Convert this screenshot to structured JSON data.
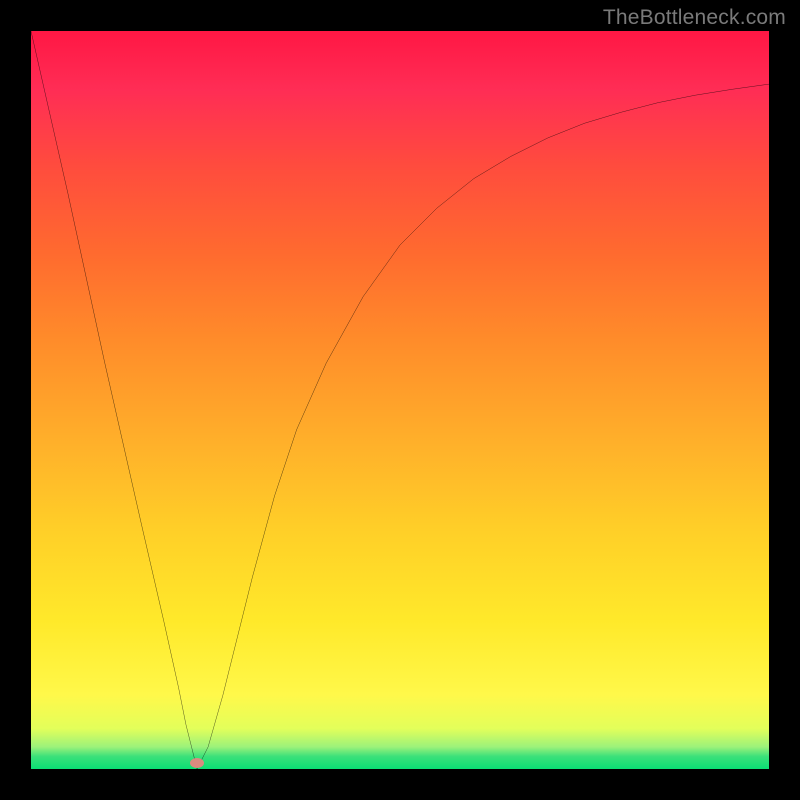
{
  "watermark": "TheBottleneck.com",
  "marker": {
    "x_pct": 22.5,
    "y_pct": 99.2
  },
  "chart_data": {
    "type": "line",
    "title": "",
    "xlabel": "",
    "ylabel": "",
    "xlim": [
      0,
      100
    ],
    "ylim": [
      0,
      100
    ],
    "series": [
      {
        "name": "bottleneck-curve",
        "x": [
          0,
          5,
          10,
          15,
          18,
          20,
          21,
          22.5,
          24,
          26,
          28,
          30,
          33,
          36,
          40,
          45,
          50,
          55,
          60,
          65,
          70,
          75,
          80,
          85,
          90,
          95,
          100
        ],
        "y": [
          100,
          78,
          55,
          33,
          20,
          11,
          6,
          0,
          3,
          10,
          18,
          26,
          37,
          46,
          55,
          64,
          71,
          76,
          80,
          83,
          85.5,
          87.5,
          89,
          90.3,
          91.3,
          92.1,
          92.8
        ]
      }
    ],
    "annotations": [
      {
        "type": "point",
        "name": "optimal-point",
        "x": 22.5,
        "y": 0
      }
    ],
    "background_gradient": {
      "direction": "vertical",
      "stops": [
        {
          "pos": 0,
          "color": "#ff1744"
        },
        {
          "pos": 0.3,
          "color": "#ff6a2f"
        },
        {
          "pos": 0.55,
          "color": "#ffae2a"
        },
        {
          "pos": 0.8,
          "color": "#ffe92a"
        },
        {
          "pos": 0.95,
          "color": "#9cf27a"
        },
        {
          "pos": 1.0,
          "color": "#0adf74"
        }
      ]
    }
  }
}
